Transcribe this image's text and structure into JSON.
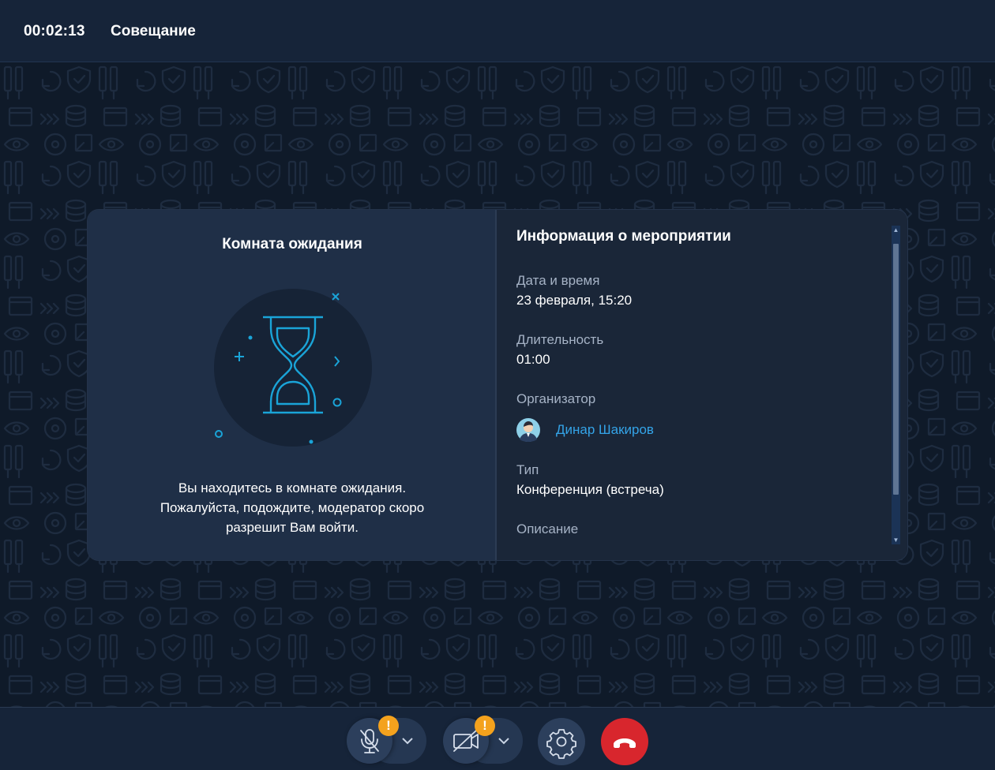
{
  "header": {
    "timer": "00:02:13",
    "title": "Совещание"
  },
  "waiting_room": {
    "title": "Комната ожидания",
    "message_line1": "Вы находитесь в комнате ожидания.",
    "message_line2": "Пожалуйста, подождите, модератор скоро",
    "message_line3": "разрешит Вам войти."
  },
  "event_info": {
    "title": "Информация о мероприятии",
    "fields": [
      {
        "label": "Дата и время",
        "value": "23 февраля, 15:20"
      },
      {
        "label": "Длительность",
        "value": "01:00"
      },
      {
        "label": "Организатор",
        "value": "Динар Шакиров"
      },
      {
        "label": "Тип",
        "value": "Конференция (встреча)"
      },
      {
        "label": "Описание",
        "value": ""
      }
    ]
  },
  "controls": {
    "mic": {
      "icon": "microphone-muted-icon",
      "warning": "!"
    },
    "camera": {
      "icon": "camera-off-icon",
      "warning": "!"
    },
    "settings": {
      "icon": "gear-icon"
    },
    "hangup": {
      "icon": "phone-hangup-icon"
    }
  },
  "colors": {
    "background": "#0f1a29",
    "bar": "#162439",
    "accent_link": "#34a4e8",
    "warning": "#f4a21d",
    "hangup": "#d8262d",
    "illustration": "#1aa4d8"
  }
}
